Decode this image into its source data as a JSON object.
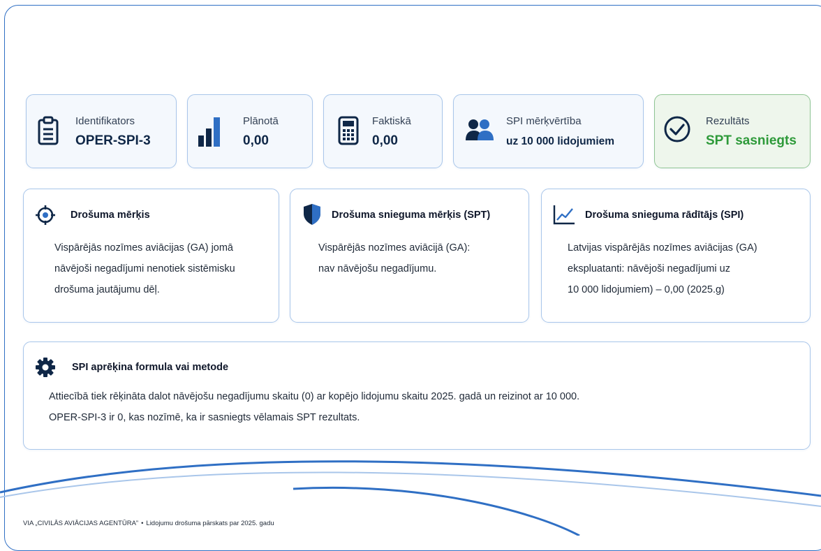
{
  "metrics": {
    "identifier": {
      "label": "Identifikators",
      "value": "OPER-SPI-3",
      "icon": "clipboard-icon"
    },
    "planned": {
      "label": "Plānotā",
      "value": "0,00",
      "icon": "bar-chart-icon"
    },
    "actual": {
      "label": "Faktiskā",
      "value": "0,00",
      "icon": "calculator-icon"
    },
    "spi_unit": {
      "label": "SPI mērķvērtība",
      "value": "uz 10 000 lidojumiem",
      "icon": "people-icon"
    },
    "result": {
      "label": "Rezultāts",
      "value": "SPT sasniegts",
      "icon": "check-circle-icon"
    }
  },
  "panels": {
    "safety_goal": {
      "title": "Drošuma mērķis",
      "icon": "target-icon",
      "lines": [
        "Vispārējās nozīmes aviācijas (GA) jomā",
        "nāvējoši negadījumi nenotiek sistēmisku",
        "drošuma jautājumu dēļ."
      ]
    },
    "spt": {
      "title": "Drošuma snieguma mērķis (SPT)",
      "icon": "shield-icon",
      "lines": [
        "Vispārējās nozīmes aviācijā (GA):",
        "nav nāvējošu negadījumu."
      ]
    },
    "spi": {
      "title": "Drošuma snieguma rādītājs (SPI)",
      "icon": "line-chart-icon",
      "lines": [
        "Latvijas vispārējās nozīmes aviācijas (GA)",
        "ekspluatanti: nāvējoši negadījumi uz",
        "10 000 lidojumiem) – 0,00 (2025.g)"
      ]
    }
  },
  "formula": {
    "title": "SPI aprēķina formula vai metode",
    "icon": "gear-icon",
    "lines": [
      "Attiecībā tiek rēķināta dalot nāvējošu negadījumu skaitu (0) ar kopējo lidojumu skaitu 2025. gadā un reizinot ar 10 000.",
      "OPER-SPI-3 ir 0, kas nozīmē, ka ir sasniegts vēlamais SPT rezultats."
    ]
  },
  "footer": {
    "org": "VIA „CIVILĀS AVIĀCIJAS AGENTŪRA”",
    "separator": "•",
    "doc": "Lidojumu drošuma pārskats par 2025. gadu"
  },
  "colors": {
    "primary": "#2f6fc4",
    "navy": "#0f2747",
    "success": "#2e9a3a",
    "card_bg": "#f4f8fd",
    "success_bg": "#eef6ec"
  }
}
